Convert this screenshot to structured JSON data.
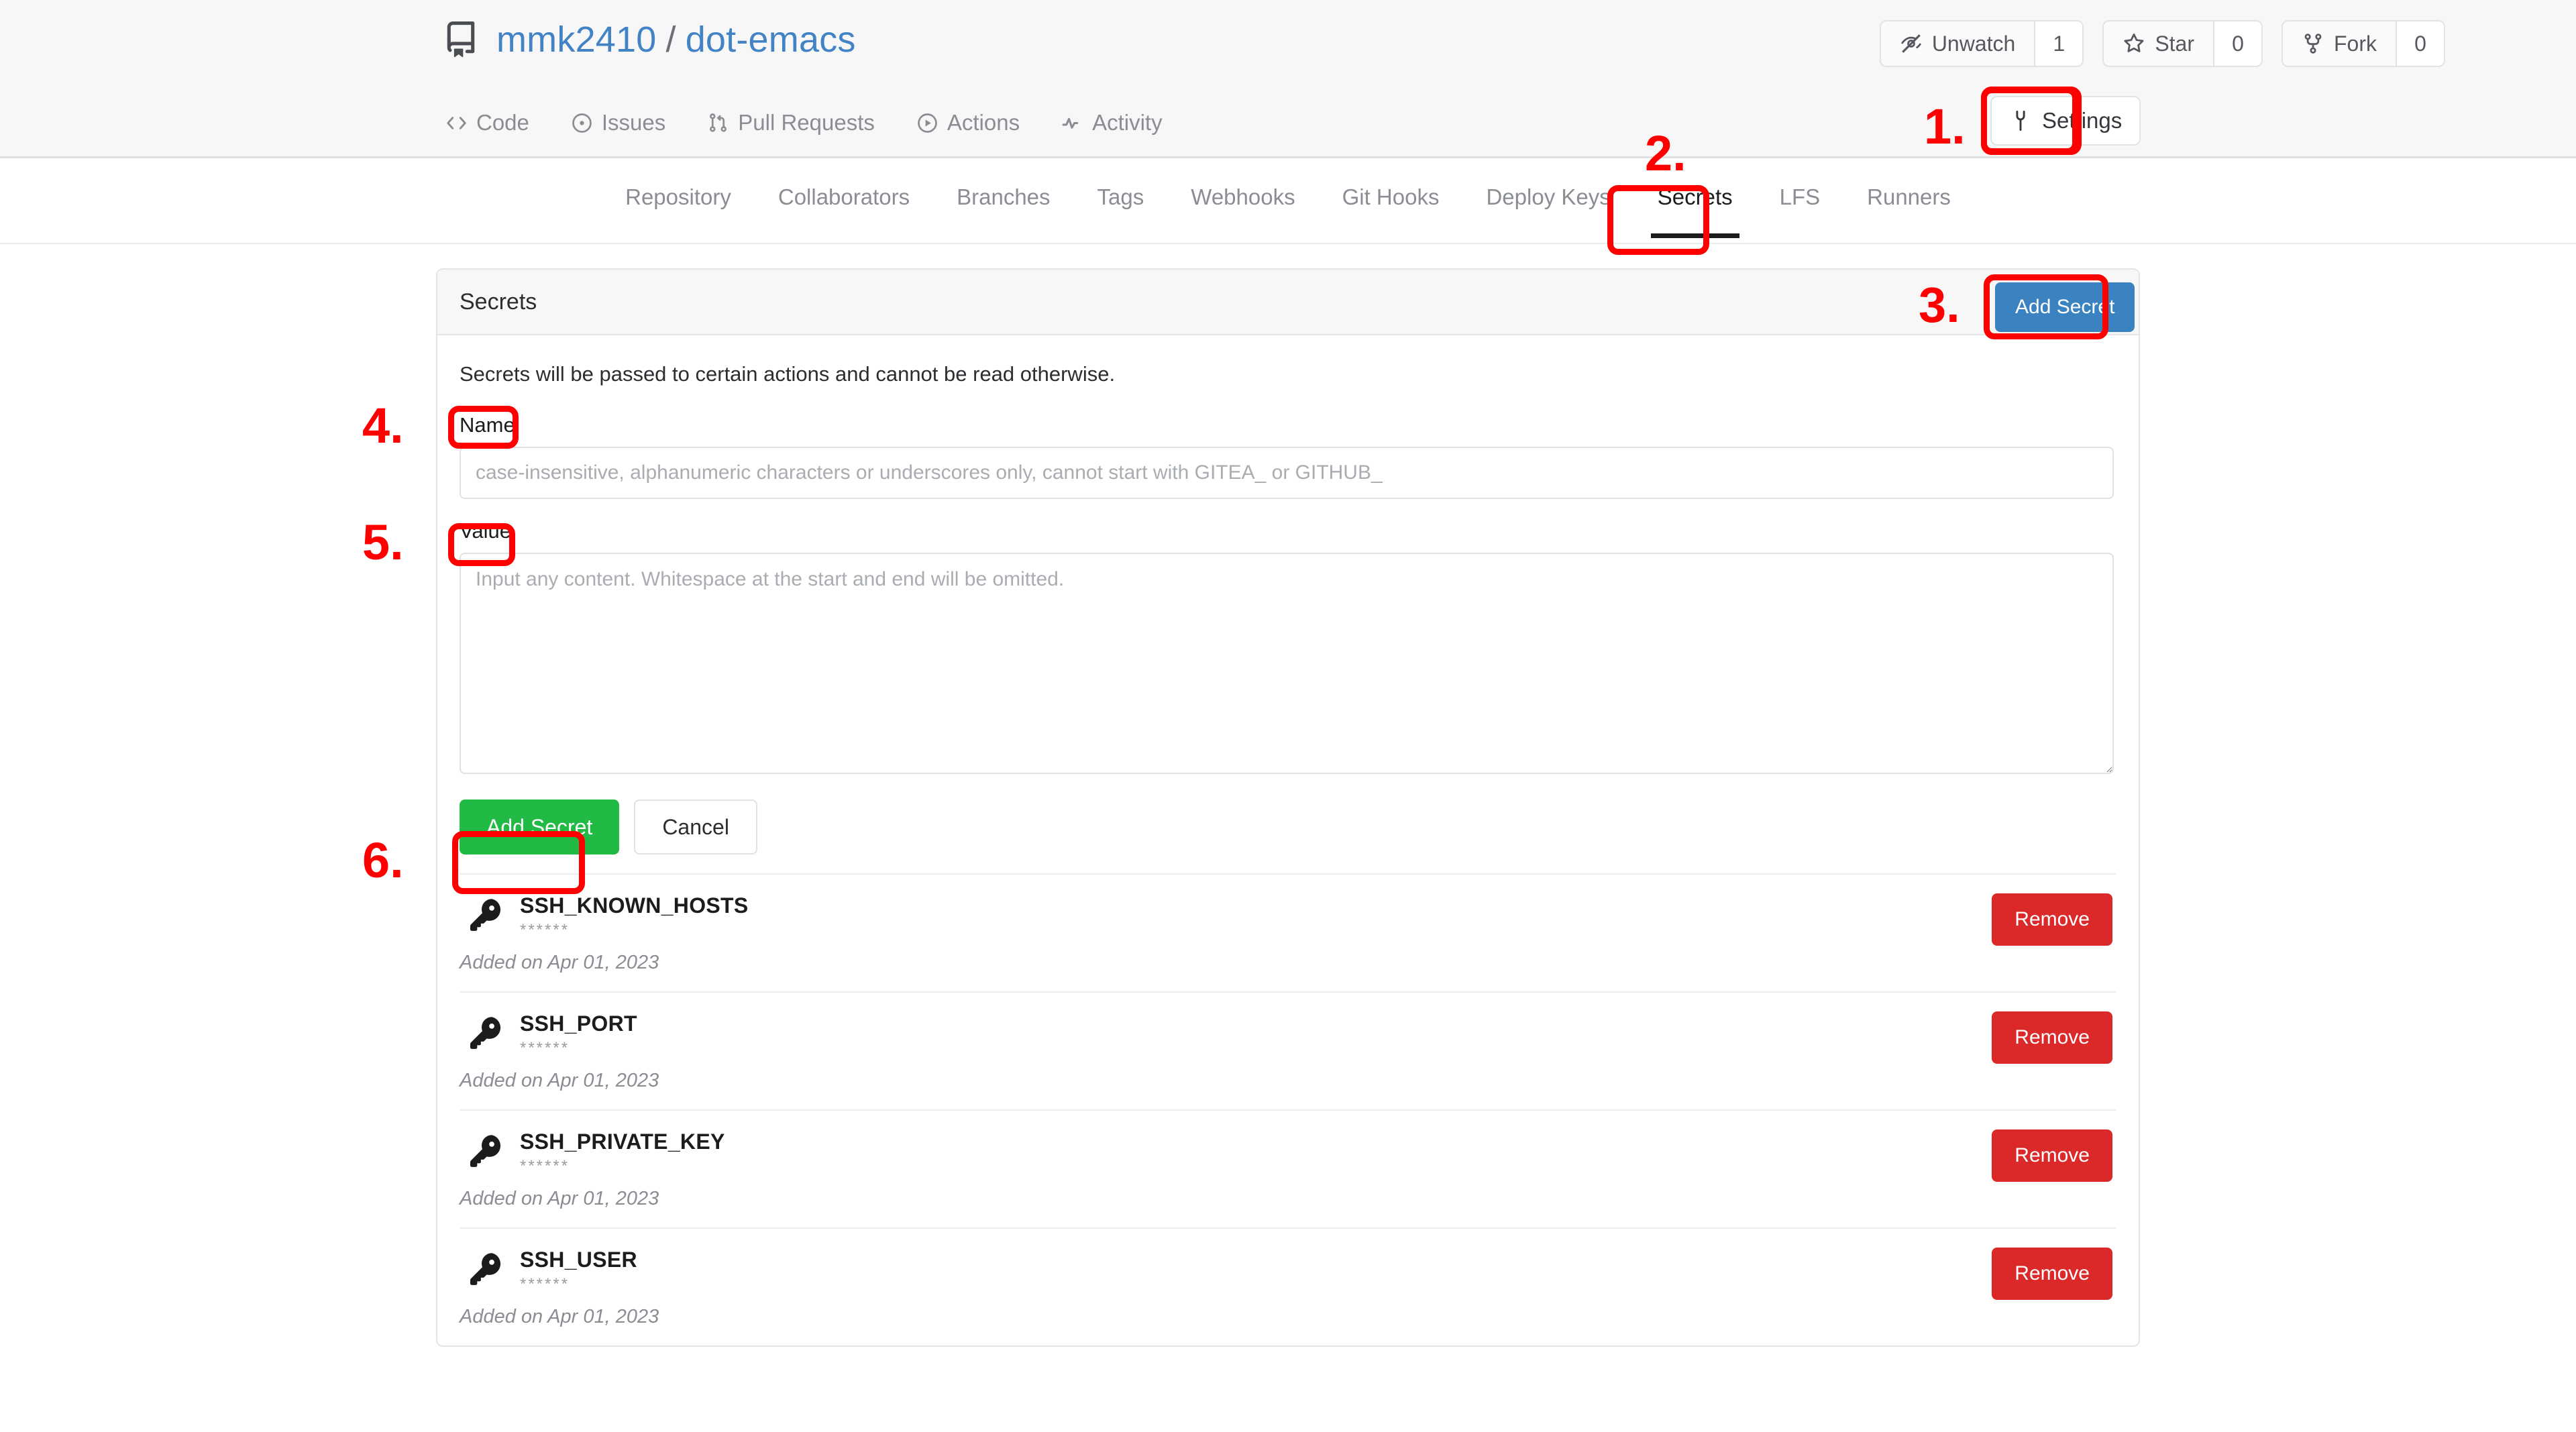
{
  "repo": {
    "icon": "repo-icon",
    "owner": "mmk2410",
    "separator": "/",
    "name": "dot-emacs"
  },
  "repo_actions": [
    {
      "icon": "unwatch-icon",
      "label": "Unwatch",
      "count": "1"
    },
    {
      "icon": "star-icon",
      "label": "Star",
      "count": "0"
    },
    {
      "icon": "fork-icon",
      "label": "Fork",
      "count": "0"
    }
  ],
  "repo_nav": [
    {
      "icon": "code-icon",
      "label": "Code"
    },
    {
      "icon": "issues-icon",
      "label": "Issues"
    },
    {
      "icon": "pull-requests-icon",
      "label": "Pull Requests"
    },
    {
      "icon": "actions-icon",
      "label": "Actions"
    },
    {
      "icon": "activity-icon",
      "label": "Activity"
    }
  ],
  "settings_button": {
    "icon": "wrench-icon",
    "label": "Settings"
  },
  "settings_nav": [
    {
      "label": "Repository",
      "active": false
    },
    {
      "label": "Collaborators",
      "active": false
    },
    {
      "label": "Branches",
      "active": false
    },
    {
      "label": "Tags",
      "active": false
    },
    {
      "label": "Webhooks",
      "active": false
    },
    {
      "label": "Git Hooks",
      "active": false
    },
    {
      "label": "Deploy Keys",
      "active": false
    },
    {
      "label": "Secrets",
      "active": true
    },
    {
      "label": "LFS",
      "active": false
    },
    {
      "label": "Runners",
      "active": false
    }
  ],
  "panel": {
    "header_title": "Secrets",
    "add_secret_button": "Add Secret",
    "description": "Secrets will be passed to certain actions and cannot be read otherwise.",
    "name_label": "Name",
    "name_placeholder": "case-insensitive, alphanumeric characters or underscores only, cannot start with GITEA_ or GITHUB_",
    "name_value": "",
    "value_label": "Value",
    "value_placeholder": "Input any content. Whitespace at the start and end will be omitted.",
    "value_value": "",
    "submit_label": "Add Secret",
    "cancel_label": "Cancel"
  },
  "secrets": [
    {
      "icon": "key-icon",
      "name": "SSH_KNOWN_HOSTS",
      "masked": "******",
      "added": "Added on Apr 01, 2023",
      "remove_label": "Remove"
    },
    {
      "icon": "key-icon",
      "name": "SSH_PORT",
      "masked": "******",
      "added": "Added on Apr 01, 2023",
      "remove_label": "Remove"
    },
    {
      "icon": "key-icon",
      "name": "SSH_PRIVATE_KEY",
      "masked": "******",
      "added": "Added on Apr 01, 2023",
      "remove_label": "Remove"
    },
    {
      "icon": "key-icon",
      "name": "SSH_USER",
      "masked": "******",
      "added": "Added on Apr 01, 2023",
      "remove_label": "Remove"
    }
  ],
  "annotations": [
    {
      "number": "1.",
      "target": "settings-button"
    },
    {
      "number": "2.",
      "target": "secrets-tab"
    },
    {
      "number": "3.",
      "target": "add-secret-top-button"
    },
    {
      "number": "4.",
      "target": "name-label"
    },
    {
      "number": "5.",
      "target": "value-label"
    },
    {
      "number": "6.",
      "target": "add-secret-submit-button"
    }
  ],
  "colors": {
    "link": "#4183c4",
    "add_secret_blue": "#3b83c0",
    "submit_green": "#21ba45",
    "remove_red": "#db2828",
    "annotation_red": "#ff0000",
    "header_bg": "#f7f7f8"
  }
}
